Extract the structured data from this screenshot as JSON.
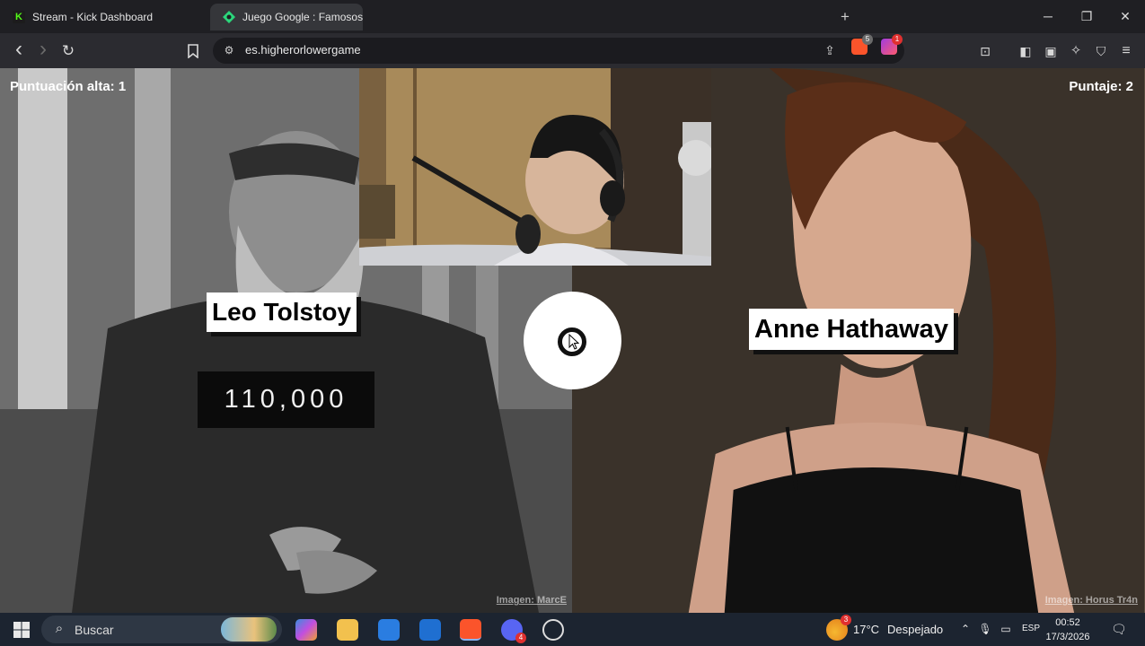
{
  "browser": {
    "tabs": [
      {
        "label": "Stream - Kick Dashboard",
        "favicon": "kick-icon"
      },
      {
        "label": "Juego Google : Famosos: ¿ ",
        "favicon": "game-icon",
        "active": true
      }
    ],
    "new_tab": "+",
    "window_controls": {
      "minimize": "─",
      "restore": "❐",
      "close": "✕"
    },
    "toolbar": {
      "back": "‹",
      "forward": "›",
      "reload": "↻",
      "bookmark": "🔖",
      "url": "es.higherorlowergame",
      "brave_badge": "5",
      "rewards_badge": "1"
    }
  },
  "game": {
    "high_score_label": "Puntuación alta: 1",
    "score_label": "Puntaje: 2",
    "left": {
      "name": "Leo Tolstoy",
      "value": "110,000",
      "credit": "Imagen: MarcE"
    },
    "right": {
      "name": "Anne Hathaway",
      "credit": "Imagen: Horus Tr4n"
    }
  },
  "taskbar": {
    "search_placeholder": "Buscar",
    "weather": {
      "temp": "17°C",
      "desc": "Despejado",
      "badge": "3"
    },
    "lang": "ESP",
    "time": "00:52",
    "date": "17/3/2026",
    "discord_badge": "4"
  },
  "colors": {
    "tab_bar": "#1f1f23",
    "toolbar": "#2b2b30",
    "taskbar": "#1c2430",
    "kick_green": "#53fc18",
    "brave_orange": "#fb542b"
  }
}
